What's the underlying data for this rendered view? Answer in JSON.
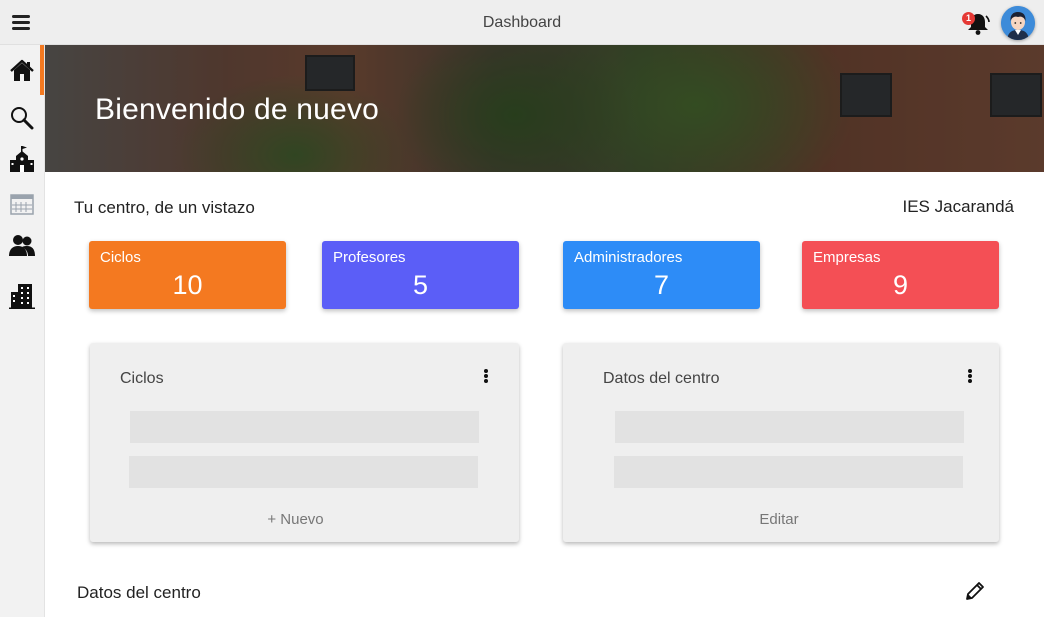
{
  "topbar": {
    "title": "Dashboard",
    "notification_count": "1",
    "menu_icon": "menu-icon",
    "bell_icon": "bell-icon",
    "avatar_icon": "user-avatar"
  },
  "sidebar": {
    "items": [
      {
        "icon": "home-icon",
        "active": true
      },
      {
        "icon": "search-icon",
        "active": false
      },
      {
        "icon": "school-icon",
        "active": false
      },
      {
        "icon": "calendar-icon",
        "active": false
      },
      {
        "icon": "users-icon",
        "active": false
      },
      {
        "icon": "building-icon",
        "active": false
      }
    ],
    "accent_color": "#f47920"
  },
  "hero": {
    "title": "Bienvenido de nuevo"
  },
  "overview": {
    "title": "Tu centro, de un vistazo",
    "center_name": "IES Jacarandá"
  },
  "stats": [
    {
      "label": "Ciclos",
      "value": "10",
      "color": "#f47920"
    },
    {
      "label": "Profesores",
      "value": "5",
      "color": "#5b5ef7"
    },
    {
      "label": "Administradores",
      "value": "7",
      "color": "#2d8cf7"
    },
    {
      "label": "Empresas",
      "value": "9",
      "color": "#f44f55"
    }
  ],
  "cards": [
    {
      "title": "Ciclos",
      "action": "+ Nuevo",
      "menu_icon": "more-vert-icon"
    },
    {
      "title": "Datos del centro",
      "action": "Editar",
      "menu_icon": "more-vert-icon"
    }
  ],
  "bottom": {
    "title": "Datos del centro",
    "edit_icon": "pencil-icon"
  }
}
